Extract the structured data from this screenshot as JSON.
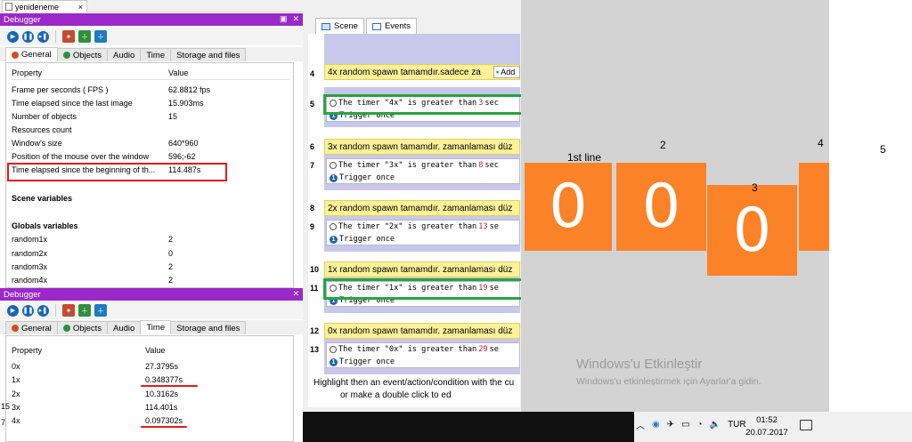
{
  "doc_tab": {
    "label": "yenideneme"
  },
  "debugger_top": {
    "title": "Debugger",
    "tabs": [
      "General",
      "Objects",
      "Audio",
      "Time",
      "Storage and files"
    ],
    "col_property": "Property",
    "col_value": "Value",
    "rows": [
      {
        "k": "Frame per seconds ( FPS )",
        "v": "62.8812 fps"
      },
      {
        "k": "Time elapsed since the last image",
        "v": "15.903ms"
      },
      {
        "k": "Number of objects",
        "v": "15"
      },
      {
        "k": "Resources count",
        "v": ""
      },
      {
        "k": "Window's size",
        "v": "640*960"
      },
      {
        "k": "Position of the mouse over the window",
        "v": "596;-62"
      },
      {
        "k": "Time elapsed since the beginning of th...",
        "v": "114.487s"
      }
    ],
    "scene_vars": "Scene variables",
    "globals": "Globals variables",
    "globals_rows": [
      {
        "k": "random1x",
        "v": "2"
      },
      {
        "k": "random2x",
        "v": "0"
      },
      {
        "k": "random3x",
        "v": "2"
      },
      {
        "k": "random4x",
        "v": "2"
      }
    ]
  },
  "debugger_bottom": {
    "title": "Debugger",
    "tabs": [
      "General",
      "Objects",
      "Audio",
      "Time",
      "Storage and files"
    ],
    "col_property": "Property",
    "col_value": "Value",
    "rows": [
      {
        "k": "0x",
        "v": "27.3795s"
      },
      {
        "k": "1x",
        "v": "0.348377s"
      },
      {
        "k": "2x",
        "v": "10.3162s"
      },
      {
        "k": "3x",
        "v": "114.401s"
      },
      {
        "k": "4x",
        "v": "0.097302s"
      }
    ]
  },
  "event_sheet": {
    "tabs": [
      "Scene",
      "Events"
    ],
    "add_label": "Add",
    "events": [
      {
        "group_num": "4",
        "group": "4x random spawn tamamdır.sadece za",
        "cond_num": "5",
        "cond": "The timer \"4x\" is greater than",
        "secs": "3",
        "suffix": " sec"
      },
      {
        "group_num": "6",
        "group": "3x random spawn tamamdır. zamanlaması düz",
        "cond_num": "7",
        "cond": "The timer \"3x\" is greater than",
        "secs": "8",
        "suffix": " sec"
      },
      {
        "group_num": "8",
        "group": "2x random spawn tamamdır. zamanlaması düz",
        "cond_num": "9",
        "cond": "The timer \"2x\" is greater than",
        "secs": "13",
        "suffix": " se"
      },
      {
        "group_num": "10",
        "group": "1x random spawn tamamdır. zamanlaması düz",
        "cond_num": "11",
        "cond": "The timer \"1x\" is greater than",
        "secs": "19",
        "suffix": " se"
      },
      {
        "group_num": "12",
        "group": "0x random spawn tamamdır. zamanlaması düz",
        "cond_num": "13",
        "cond": "The timer \"0x\" is greater than",
        "secs": "29",
        "suffix": " se"
      }
    ],
    "trigger": "Trigger once",
    "footer1": "Highlight then an event/action/condition with the cu",
    "footer2": "or make a double click to ed"
  },
  "game": {
    "label_1": "1st line",
    "label_2": "2",
    "label_3": "3",
    "label_4": "4",
    "label_5": "5",
    "box_values": [
      "0",
      "0",
      "0"
    ],
    "watermark_title": "Windows'u Etkinleştir",
    "watermark_sub": "Windows'u etkinleştirmek için Ayarlar'a gidin."
  },
  "taskbar": {
    "lang": "TUR",
    "time": "01:52",
    "date": "20.07.2017"
  },
  "left_edge": {
    "text1": "15",
    "text2": "7"
  },
  "colors": {
    "debugger_purple": "#9b28c8",
    "orange": "#fc8228",
    "highlight_red": "#e11b1b",
    "highlight_green": "#24a540"
  }
}
